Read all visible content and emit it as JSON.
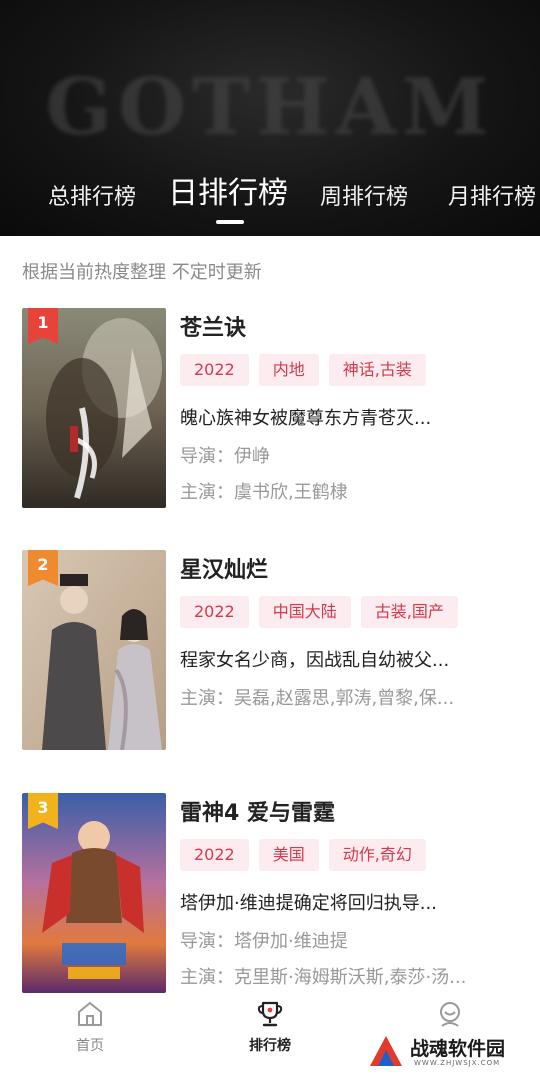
{
  "banner": {
    "logo_text": "GOTHAM",
    "tabs": [
      {
        "label": "总排行榜",
        "active": false
      },
      {
        "label": "日排行榜",
        "active": true
      },
      {
        "label": "周排行榜",
        "active": false
      },
      {
        "label": "月排行榜",
        "active": false
      }
    ]
  },
  "subtitle": "根据当前热度整理 不定时更新",
  "items": [
    {
      "rank": "1",
      "badge_color": "#e8433a",
      "title": "苍兰诀",
      "tags": [
        "2022",
        "内地",
        "神话,古装"
      ],
      "desc": "魄心族神女被魔尊东方青苍灭...",
      "director": "导演：伊峥",
      "cast": "主演：虞书欣,王鹤棣"
    },
    {
      "rank": "2",
      "badge_color": "#f08a2e",
      "title": "星汉灿烂",
      "tags": [
        "2022",
        "中国大陆",
        "古装,国产"
      ],
      "desc": "程家女名少商，因战乱自幼被父...",
      "director": "",
      "cast": "主演：吴磊,赵露思,郭涛,曾黎,保..."
    },
    {
      "rank": "3",
      "badge_color": "#f2b21b",
      "title": "雷神4 爱与雷霆",
      "tags": [
        "2022",
        "美国",
        "动作,奇幻"
      ],
      "desc": "塔伊加·维迪提确定将回归执导...",
      "director": "导演：塔伊加·维迪提",
      "cast": "主演：克里斯·海姆斯沃斯,泰莎·汤..."
    }
  ],
  "nav": {
    "home": "首页",
    "ranking": "排行榜",
    "profile": ""
  },
  "watermark": {
    "text": "战魂软件园",
    "url": "WWW.ZHJWSJX.COM"
  },
  "colors": {
    "tag_bg": "#fdecef",
    "tag_text": "#d13a4f"
  }
}
